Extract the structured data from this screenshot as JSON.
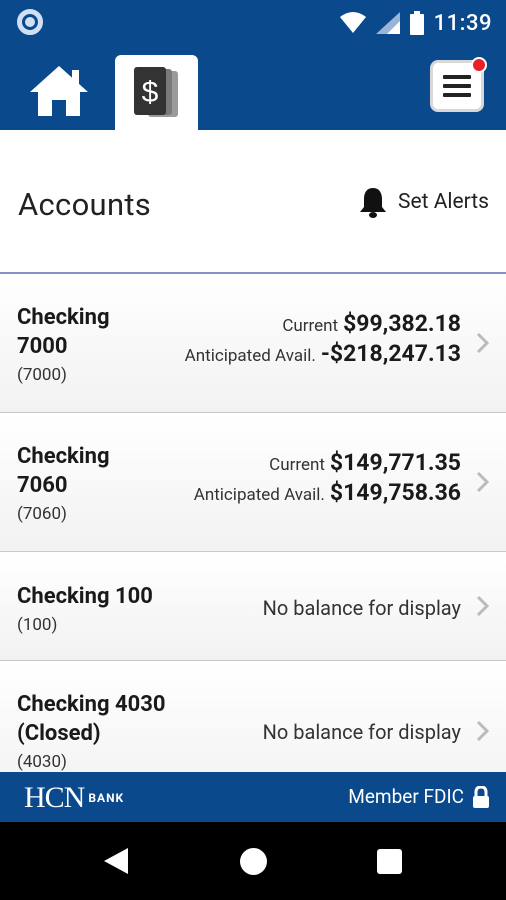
{
  "status_bar": {
    "time": "11:39"
  },
  "header": {
    "home_icon": "home-icon",
    "accounts_icon": "dollar-cards-icon",
    "menu_icon": "hamburger-menu-icon"
  },
  "page": {
    "title": "Accounts",
    "alerts_label": "Set Alerts"
  },
  "accounts": [
    {
      "name_line1": "Checking",
      "name_line2": "7000",
      "number": "(7000)",
      "current_label": "Current",
      "current": "$99,382.18",
      "anticipated_label": "Anticipated Avail.",
      "anticipated": "-$218,247.13"
    },
    {
      "name_line1": "Checking",
      "name_line2": "7060",
      "number": "(7060)",
      "current_label": "Current",
      "current": "$149,771.35",
      "anticipated_label": "Anticipated Avail.",
      "anticipated": "$149,758.36"
    },
    {
      "name_line1": "Checking 100",
      "number": "(100)",
      "no_balance": "No balance for display"
    },
    {
      "name_line1": "Checking 4030",
      "name_line2": "(Closed)",
      "number": "(4030)",
      "no_balance": "No balance for display"
    }
  ],
  "footer": {
    "logo_text": "HCN",
    "logo_sub": "BANK",
    "fdic_label": "Member FDIC"
  },
  "colors": {
    "brand_blue": "#0a4a8c",
    "badge_red": "#e8202a",
    "divider": "#8c8cc8"
  }
}
